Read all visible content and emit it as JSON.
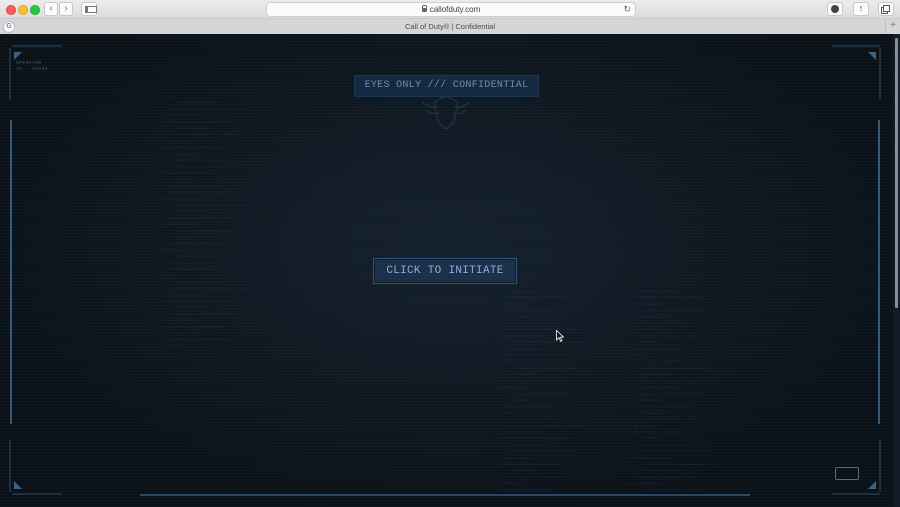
{
  "browser": {
    "url": "callofduty.com",
    "tab_title": "Call of Duty® | Confidential",
    "favicon_letter": "G",
    "icons": {
      "back": "chevron-left-icon",
      "forward": "chevron-right-icon",
      "sidebar": "sidebar-icon",
      "lock": "lock-icon",
      "reload": "reload-icon",
      "download": "download-icon",
      "share": "share-icon",
      "tabs": "tabs-icon",
      "new_tab": "plus-icon"
    }
  },
  "page": {
    "operator_id": "OPERATOR",
    "operator_code": "ID - 39308",
    "banner": "EYES ONLY /// CONFIDENTIAL",
    "initiate_button": "CLICK TO INITIATE",
    "colors": {
      "background": "#0f1a24",
      "accent": "#8caed3",
      "frame": "#2b4a66"
    }
  }
}
